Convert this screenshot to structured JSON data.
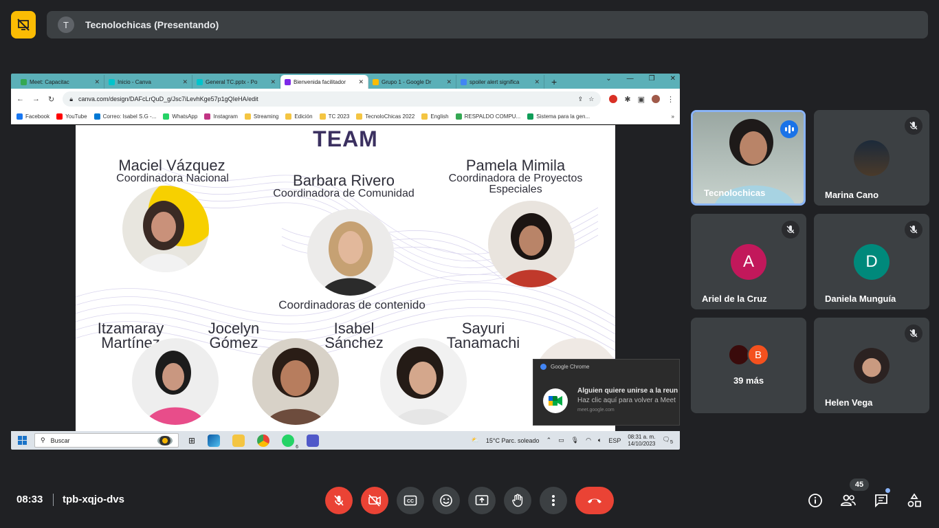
{
  "presenter": {
    "avatar_letter": "T",
    "title": "Tecnolochicas (Presentando)"
  },
  "browser": {
    "tabs": [
      {
        "label": "Meet: Capacitac",
        "favicon_color": "#34a853"
      },
      {
        "label": "Inicio - Canva",
        "favicon_color": "#00c4cc"
      },
      {
        "label": "General TC.pptx - Po",
        "favicon_color": "#00c4cc"
      },
      {
        "label": "Bienvenida facilitador",
        "favicon_color": "#7d2ae8"
      },
      {
        "label": "Grupo 1 - Google Dr",
        "favicon_color": "#fbbc04"
      },
      {
        "label": "spoiler alert significa",
        "favicon_color": "#4285f4"
      }
    ],
    "url": "canva.com/design/DAFcLrQuD_g/Jsc7iLevhKge57p1gQIeHA/edit",
    "bookmarks": [
      {
        "label": "Facebook",
        "color": "#1877f2"
      },
      {
        "label": "YouTube",
        "color": "#ff0000"
      },
      {
        "label": "Correo: Isabel S.G -...",
        "color": "#0078d4"
      },
      {
        "label": "WhatsApp",
        "color": "#25d366"
      },
      {
        "label": "Instagram",
        "color": "#c13584"
      },
      {
        "label": "Streaming",
        "color": "#f4c542"
      },
      {
        "label": "Edición",
        "color": "#f4c542"
      },
      {
        "label": "TC 2023",
        "color": "#f4c542"
      },
      {
        "label": "TecnoloChicas 2022",
        "color": "#f4c542"
      },
      {
        "label": "English",
        "color": "#f4c542"
      },
      {
        "label": "RESPALDO COMPU...",
        "color": "#34a853"
      },
      {
        "label": "Sistema para la gen...",
        "color": "#0f9d58"
      }
    ]
  },
  "slide": {
    "title": "TEAM",
    "people": {
      "maciel_name": "Maciel Vázquez",
      "maciel_role": "Coordinadora Nacional",
      "barbara_name": "Barbara Rivero",
      "barbara_role": "Coordinadora de Comunidad",
      "pamela_name": "Pamela Mimila",
      "pamela_role_1": "Coordinadora de Proyectos",
      "pamela_role_2": "Especiales",
      "content_heading": "Coordinadoras de contenido",
      "itzamaray_1": "Itzamaray",
      "itzamaray_2": "Martínez",
      "jocelyn_1": "Jocelyn",
      "jocelyn_2": "Gómez",
      "isabel_1": "Isabel",
      "isabel_2": "Sánchez",
      "sayuri_1": "Sayuri",
      "sayuri_2": "Tanamachi"
    }
  },
  "notification": {
    "app": "Google Chrome",
    "line1": "Alguien quiere unirse a la reun",
    "line2": "Haz clic aquí para volver a Meet",
    "source": "meet.google.com"
  },
  "taskbar": {
    "search_placeholder": "Buscar",
    "weather": "15°C  Parc. soleado",
    "lang": "ESP",
    "time": "08:31 a. m.",
    "date": "14/10/2023",
    "whatsapp_badge": "6",
    "notif_count": "5"
  },
  "participants": {
    "p1": {
      "name": "Tecnolochicas"
    },
    "p2": {
      "name": "Marina Cano"
    },
    "p3": {
      "name": "Ariel de la Cruz",
      "initial": "A",
      "color": "#c2185b"
    },
    "p4": {
      "name": "Daniela Munguía",
      "initial": "D",
      "color": "#00897b"
    },
    "more": {
      "label": "39 más",
      "initial": "B",
      "color": "#f4511e"
    },
    "p6": {
      "name": "Helen Vega"
    }
  },
  "meeting": {
    "time": "08:33",
    "code": "tpb-xqjo-dvs",
    "participant_count": "45"
  }
}
